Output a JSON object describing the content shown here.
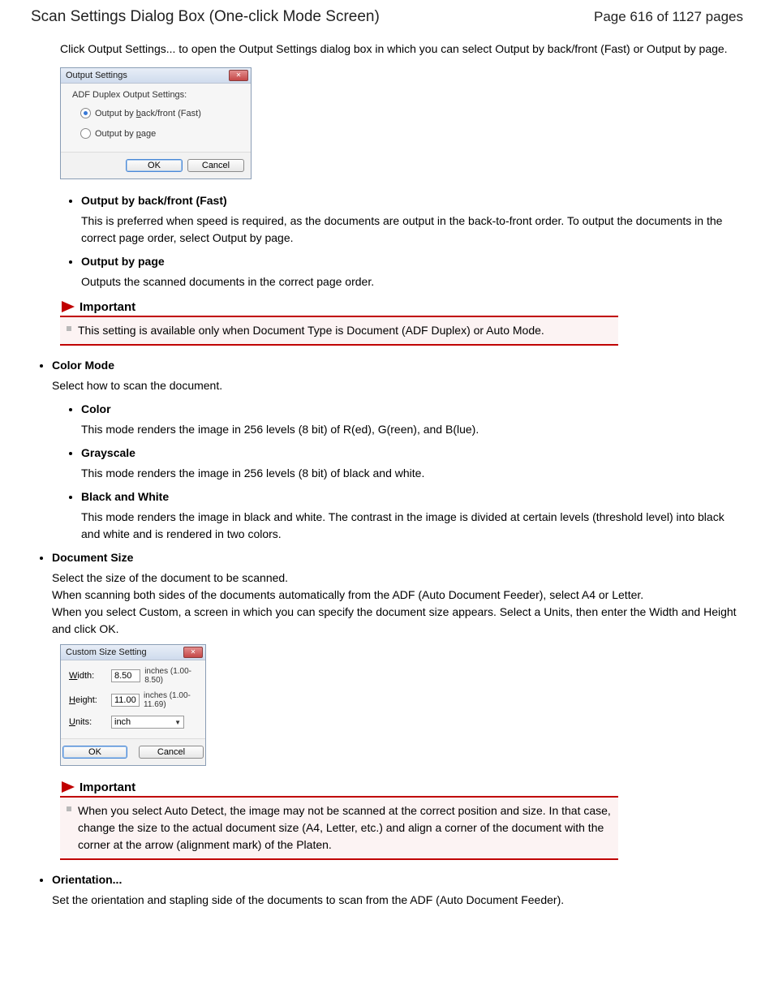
{
  "header": {
    "title": "Scan Settings Dialog Box (One-click Mode Screen)",
    "page_info": "Page 616 of 1127 pages"
  },
  "intro": "Click Output Settings... to open the Output Settings dialog box in which you can select Output by back/front (Fast) or Output by page.",
  "output_dialog": {
    "title": "Output Settings",
    "subtitle": "ADF Duplex Output Settings:",
    "option1_prefix": "Output by ",
    "option1_accel": "b",
    "option1_suffix": "ack/front (Fast)",
    "option2_prefix": "Output by ",
    "option2_accel": "p",
    "option2_suffix": "age",
    "ok": "OK",
    "cancel": "Cancel"
  },
  "output_items": {
    "item1": {
      "title": "Output by back/front (Fast)",
      "desc": "This is preferred when speed is required, as the documents are output in the back-to-front order. To output the documents in the correct page order, select Output by page."
    },
    "item2": {
      "title": "Output by page",
      "desc": "Outputs the scanned documents in the correct page order."
    }
  },
  "important1": {
    "label": "Important",
    "text": "This setting is available only when Document Type is Document (ADF Duplex) or Auto Mode."
  },
  "color_mode": {
    "title": "Color Mode",
    "desc": "Select how to scan the document.",
    "sub": {
      "color": {
        "title": "Color",
        "desc": "This mode renders the image in 256 levels (8 bit) of R(ed), G(reen), and B(lue)."
      },
      "gray": {
        "title": "Grayscale",
        "desc": "This mode renders the image in 256 levels (8 bit) of black and white."
      },
      "bw": {
        "title": "Black and White",
        "desc": "This mode renders the image in black and white. The contrast in the image is divided at certain levels (threshold level) into black and white and is rendered in two colors."
      }
    }
  },
  "doc_size": {
    "title": "Document Size",
    "desc": "Select the size of the document to be scanned.\nWhen scanning both sides of the documents automatically from the ADF (Auto Document Feeder), select A4 or Letter.\nWhen you select Custom, a screen in which you can specify the document size appears. Select a Units, then enter the Width and Height and click OK."
  },
  "custom_dialog": {
    "title": "Custom Size Setting",
    "width_label_accel": "W",
    "width_label_rest": "idth:",
    "width_value": "8.50",
    "width_range": "inches (1.00-8.50)",
    "height_label_accel": "H",
    "height_label_rest": "eight:",
    "height_value": "11.00",
    "height_range": "inches (1.00-11.69)",
    "units_label_accel": "U",
    "units_label_rest": "nits:",
    "units_value": "inch",
    "ok": "OK",
    "cancel": "Cancel"
  },
  "important2": {
    "label": "Important",
    "text": "When you select Auto Detect, the image may not be scanned at the correct position and size. In that case, change the size to the actual document size (A4, Letter, etc.) and align a corner of the document with the corner at the arrow (alignment mark) of the Platen."
  },
  "orientation": {
    "title": "Orientation...",
    "desc": "Set the orientation and stapling side of the documents to scan from the ADF (Auto Document Feeder)."
  }
}
